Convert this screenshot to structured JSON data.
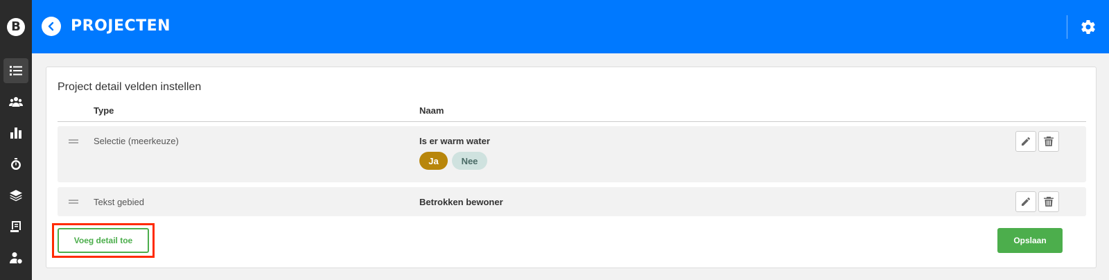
{
  "app": {
    "logo_letter": "B"
  },
  "header": {
    "title": "PROJECTEN"
  },
  "sidebar": {
    "items": [
      {
        "icon": "list-icon",
        "active": true
      },
      {
        "icon": "users-icon",
        "active": false
      },
      {
        "icon": "bar-chart-icon",
        "active": false
      },
      {
        "icon": "stopwatch-icon",
        "active": false
      },
      {
        "icon": "layers-icon",
        "active": false
      },
      {
        "icon": "document-icon",
        "active": false
      },
      {
        "icon": "user-settings-icon",
        "active": false
      }
    ]
  },
  "card": {
    "title": "Project detail velden instellen",
    "columns": {
      "type": "Type",
      "name": "Naam"
    },
    "rows": [
      {
        "type": "Selectie (meerkeuze)",
        "name": "Is er warm water",
        "options": [
          "Ja",
          "Nee"
        ]
      },
      {
        "type": "Tekst gebied",
        "name": "Betrokken bewoner"
      }
    ],
    "add_label": "Voeg detail toe",
    "save_label": "Opslaan"
  },
  "colors": {
    "header": "#0079ff",
    "sidebar": "#2b2b2b",
    "success": "#4cae4c",
    "chip_ja": "#b8860b",
    "chip_nee": "#cfe2df",
    "highlight": "#ff2a00"
  }
}
